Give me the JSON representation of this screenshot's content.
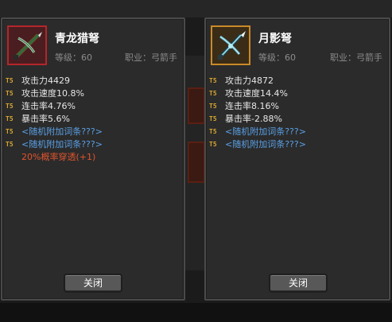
{
  "left_item": {
    "name": "青龙猎弩",
    "level": "等级：60",
    "class": "职业：弓箭手",
    "icon": "crossbow-icon",
    "border_color": "#b3262b",
    "stats": [
      "攻击力4429",
      "攻击速度10.8%",
      "连击率4.76%",
      "暴击率5.6%"
    ],
    "affixes": [
      "<随机附加词条???>",
      "<随机附加词条???>"
    ],
    "bonus": "20%概率穿透(+1)",
    "tag": "T5",
    "close_label": "关闭"
  },
  "right_item": {
    "name": "月影弩",
    "level": "等级：60",
    "class": "职业：弓箭手",
    "icon": "crossbow-icon",
    "border_color": "#c98a28",
    "stats": [
      "攻击力4872",
      "攻击速度14.4%",
      "连击率8.16%",
      "暴击率-2.88%"
    ],
    "affixes": [
      "<随机附加词条???>",
      "<随机附加词条???>"
    ],
    "tag": "T5",
    "close_label": "关闭"
  },
  "colors": {
    "stat_text": "#e6e6e6",
    "affix_text": "#5aa0e6",
    "bonus_text": "#e0542c",
    "tag": "#d9a630"
  }
}
